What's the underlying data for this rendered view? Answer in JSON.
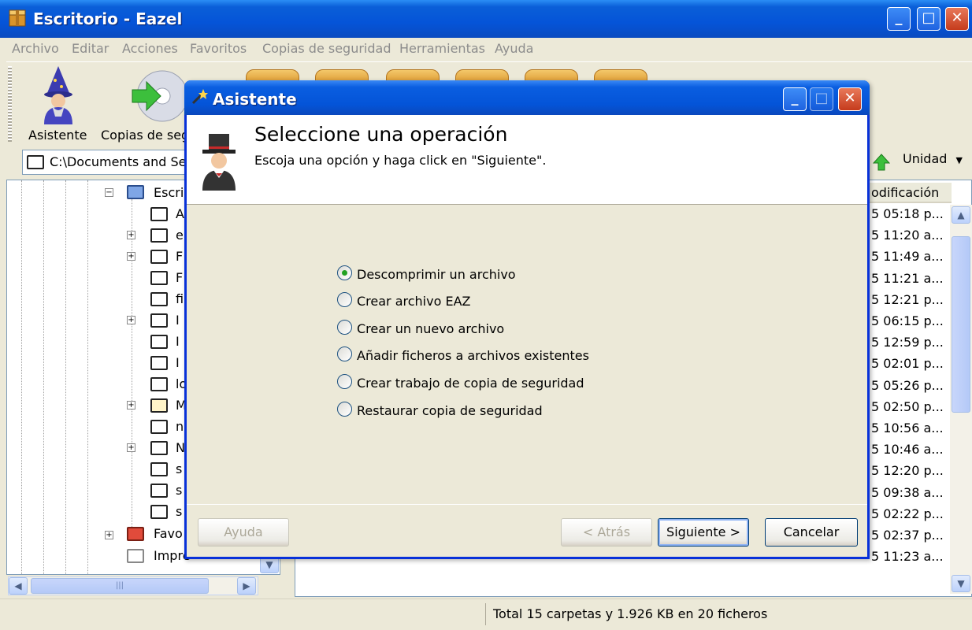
{
  "window": {
    "title": "Escritorio - Eazel",
    "min_glyph": "_",
    "max_glyph": "□",
    "close_glyph": "✕"
  },
  "menu": [
    "Archivo",
    "Editar",
    "Acciones",
    "Favoritos",
    "Copias de seguridad",
    "Herramientas",
    "Ayuda"
  ],
  "toolbar": {
    "wizard_label": "Asistente",
    "backup_label": "Copias de seg"
  },
  "address": {
    "path": "C:\\Documents and Se",
    "unit_label": "Unidad"
  },
  "tree": {
    "root_label": "Escri",
    "children": [
      "A",
      "e",
      "F",
      "F",
      "fi",
      "I",
      "I",
      "I",
      "lo",
      "M",
      "n",
      "N",
      "s",
      "s",
      "s"
    ],
    "favorites": "Favo",
    "printers": "Impre"
  },
  "list": {
    "column_modified": "odificación",
    "rows": [
      "5 05:18 p...",
      "5 11:20 a...",
      "5 11:49 a...",
      "5 11:21 a...",
      "5 12:21 p...",
      "5 06:15 p...",
      "5 12:59 p...",
      "5 02:01 p...",
      "5 05:26 p...",
      "5 02:50 p...",
      "5 10:56 a...",
      "5 10:46 a...",
      "5 12:20 p...",
      "5 09:38 a...",
      "5 02:22 p...",
      "5 02:37 p...",
      "5 11:23 a..."
    ]
  },
  "status": {
    "summary": "Total 15 carpetas y 1.926 KB en 20 ficheros"
  },
  "dialog": {
    "title": "Asistente",
    "heading": "Seleccione una operación",
    "subheading": "Escoja una opción y haga click en \"Siguiente\".",
    "options": [
      {
        "label": "Descomprimir un archivo",
        "selected": true
      },
      {
        "label": "Crear archivo EAZ",
        "selected": false
      },
      {
        "label": "Crear un nuevo archivo",
        "selected": false
      },
      {
        "label": "Añadir ficheros a archivos existentes",
        "selected": false
      },
      {
        "label": "Crear trabajo de copia de seguridad",
        "selected": false
      },
      {
        "label": "Restaurar copia de seguridad",
        "selected": false
      }
    ],
    "buttons": {
      "help": "Ayuda",
      "back": "< Atrás",
      "next": "Siguiente >",
      "cancel": "Cancelar"
    }
  },
  "colors": {
    "titlebar": "#0554d8",
    "dialog_border": "#0831d9",
    "radio_selected": "#21a121"
  }
}
